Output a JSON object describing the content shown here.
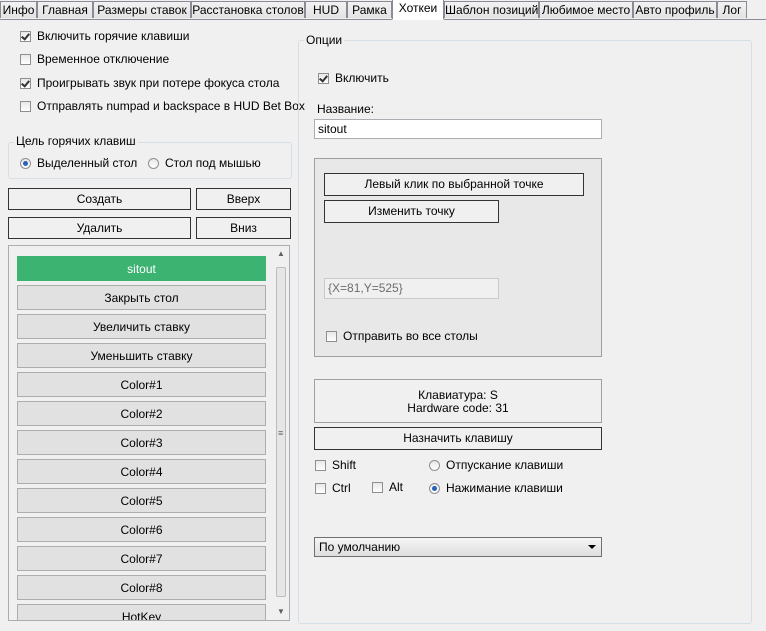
{
  "tabs": [
    "Инфо",
    "Главная",
    "Размеры ставок",
    "Расстановка столов",
    "HUD",
    "Рамка",
    "Хоткеи",
    "Шаблон позиций",
    "Любимое место",
    "Авто профиль",
    "Лог"
  ],
  "left": {
    "enable_hotkeys": "Включить горячие клавиши",
    "temp_disable": "Временное отключение",
    "play_sound": "Проигрывать звук при потере фокуса стола",
    "send_numpad": "Отправлять numpad и backspace в HUD Bet Box",
    "target_group": "Цель горячих клавиш",
    "target_selected": "Выделенный стол",
    "target_mouse": "Стол под мышью",
    "create": "Создать",
    "up": "Вверх",
    "delete": "Удалить",
    "down": "Вниз"
  },
  "hotkeys": [
    "sitout",
    "Закрыть стол",
    "Увеличить ставку",
    "Уменьшить ставку",
    "Color#1",
    "Color#2",
    "Color#3",
    "Color#4",
    "Color#5",
    "Color#6",
    "Color#7",
    "Color#8",
    "HotKey"
  ],
  "options": {
    "title": "Опции",
    "enable": "Включить",
    "name_label": "Название:",
    "name_value": "sitout",
    "action": "Левый клик по выбранной точке",
    "change_point": "Изменить точку",
    "point": "{X=81,Y=525}",
    "send_all": "Отправить во все столы",
    "keyboard": "Клавиатура: S",
    "hardware": "Hardware code: 31",
    "assign": "Назначить клавишу",
    "shift": "Shift",
    "ctrl": "Ctrl",
    "alt": "Alt",
    "release": "Отпускание клавиши",
    "press": "Нажимание клавиши",
    "dropdown": "По умолчанию"
  }
}
